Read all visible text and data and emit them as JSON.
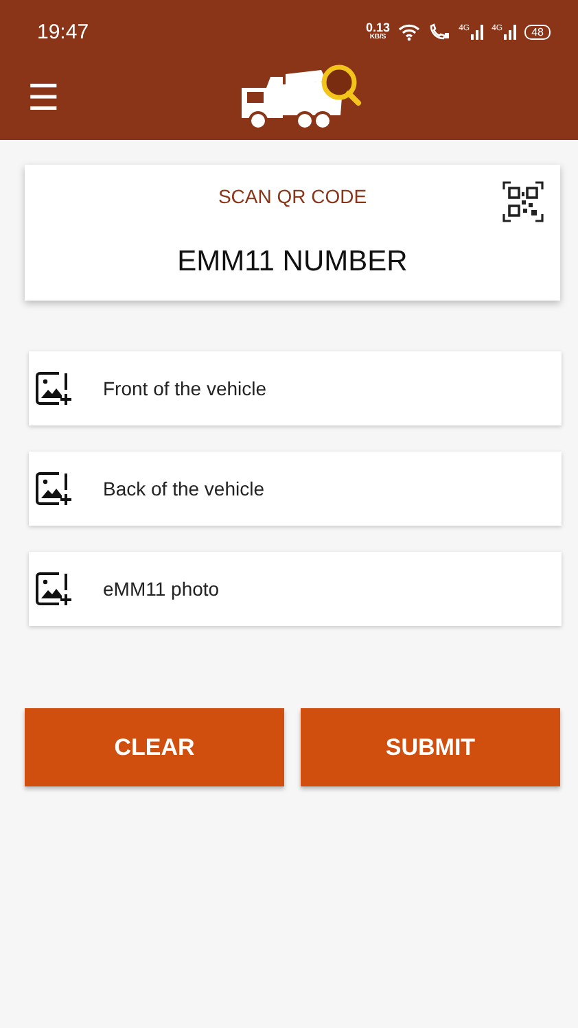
{
  "status_bar": {
    "time": "19:47",
    "net_speed": "0.13",
    "net_unit": "KB/S",
    "signals": [
      "4G",
      "4G"
    ],
    "battery": "48"
  },
  "app_bar": {
    "menu": "☰"
  },
  "scan_card": {
    "label": "SCAN QR CODE",
    "title": "EMM11 NUMBER"
  },
  "photo_rows": [
    {
      "label": "Front of the vehicle"
    },
    {
      "label": "Back of the vehicle"
    },
    {
      "label": "eMM11 photo"
    }
  ],
  "buttons": [
    {
      "label": "CLEAR"
    },
    {
      "label": "SUBMIT"
    }
  ]
}
